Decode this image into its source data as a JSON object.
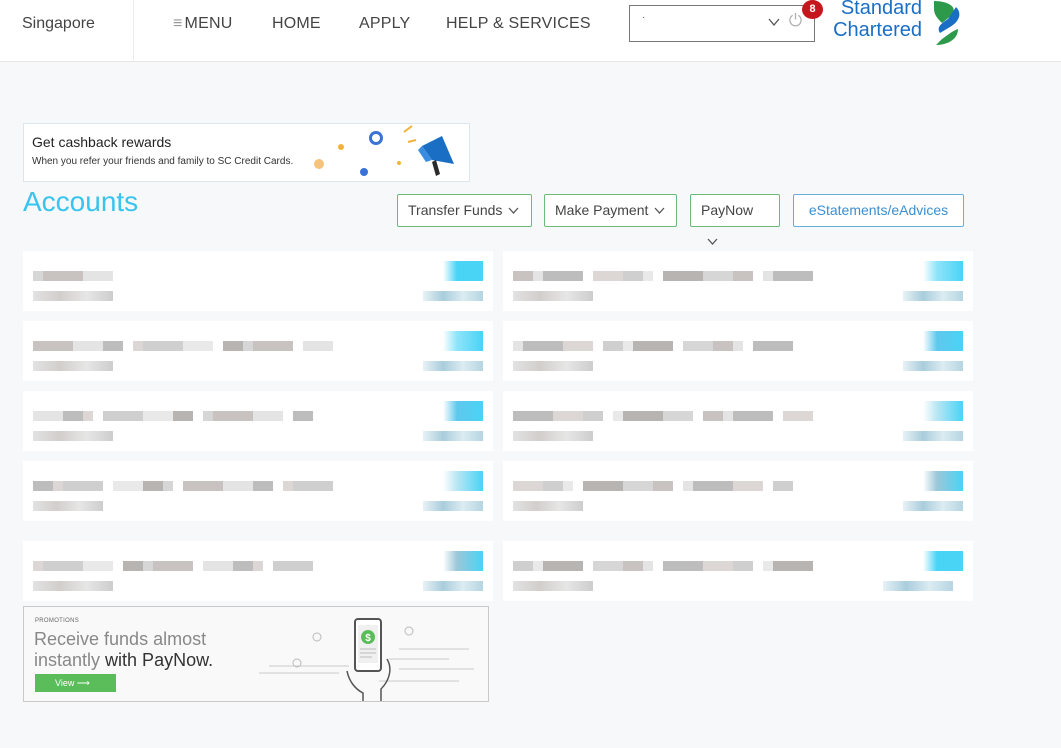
{
  "header": {
    "country": "Singapore",
    "nav": {
      "menu": "MENU",
      "home": "HOME",
      "apply": "APPLY",
      "help": "HELP & SERVICES"
    },
    "account_selector_value": "·",
    "notification_count": "8",
    "logo": {
      "line1": "Standard",
      "line2": "Chartered"
    }
  },
  "cashback_banner": {
    "title": "Get cashback rewards",
    "subtitle": "When you refer your friends and family to SC Credit Cards."
  },
  "accounts": {
    "title": "Accounts",
    "actions": {
      "transfer_funds": "Transfer Funds",
      "make_payment": "Make Payment",
      "paynow": "PayNow",
      "estatements": "eStatements/eAdvices"
    }
  },
  "promo": {
    "tag": "PROMOTIONS",
    "line1": "Receive funds almost",
    "line2_plain": "instantly ",
    "line2_bold": "with PayNow.",
    "button": "View"
  },
  "icons": {
    "hamburger": "hamburger-icon",
    "chevron": "chevron-down-icon",
    "power": "power-icon",
    "megaphone": "megaphone-icon",
    "phone_paynow": "phone-dollar-icon"
  },
  "colors": {
    "accent": "#38c4ee",
    "brand_blue": "#1a6fc4",
    "brand_green": "#2c9a4a",
    "action_green": "#6dbb7a",
    "badge_red": "#c5161d",
    "promo_green": "#5bbd5a"
  }
}
